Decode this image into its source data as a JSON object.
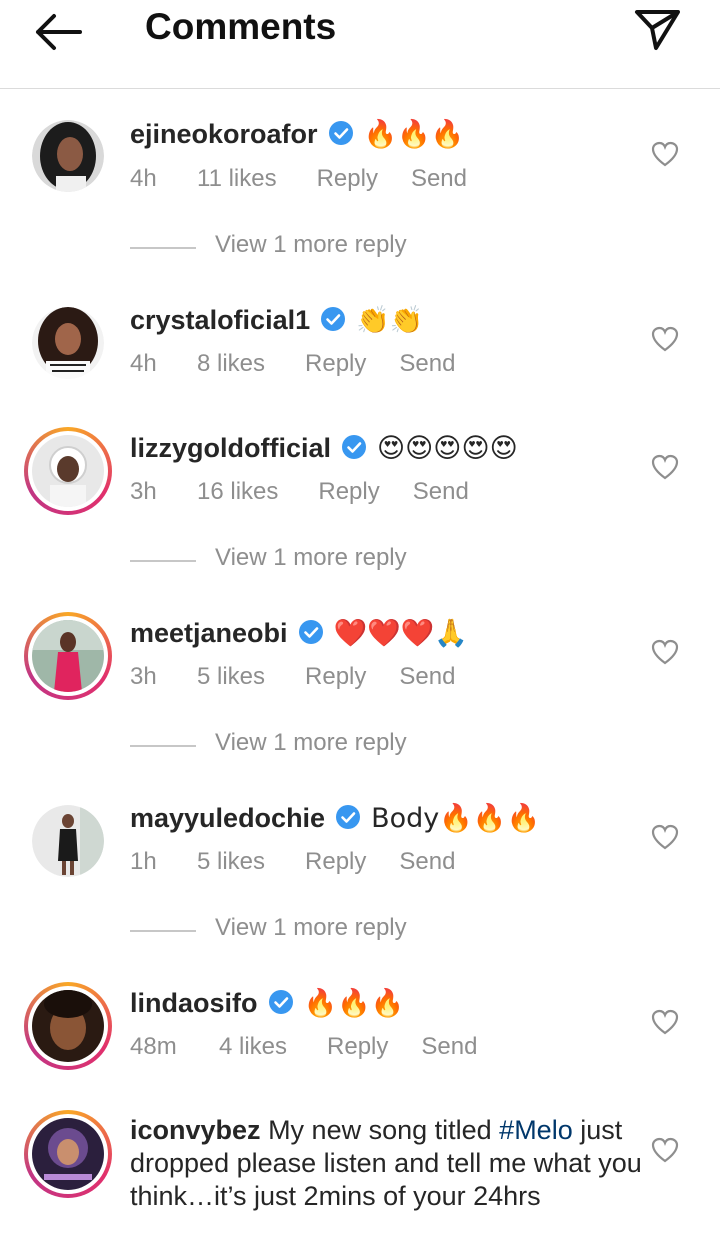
{
  "header": {
    "title": "Comments",
    "back_icon": "arrow-left-icon",
    "send_icon": "paper-plane-icon"
  },
  "comments": [
    {
      "username": "ejineokoroafor",
      "text": "🔥🔥🔥",
      "time": "4h",
      "likes": "11 likes",
      "reply": "Reply",
      "send": "Send",
      "view_more": "View 1 more reply"
    },
    {
      "username": "crystaloficial1",
      "text": "👏👏",
      "time": "4h",
      "likes": "8 likes",
      "reply": "Reply",
      "send": "Send"
    },
    {
      "username": "lizzygoldofficial",
      "text": "😍😍😍😍😍",
      "time": "3h",
      "likes": "16 likes",
      "reply": "Reply",
      "send": "Send",
      "view_more": "View 1 more reply"
    },
    {
      "username": "meetjaneobi",
      "text": "❤️❤️❤️🙏",
      "time": "3h",
      "likes": "5 likes",
      "reply": "Reply",
      "send": "Send",
      "view_more": "View 1 more reply"
    },
    {
      "username": "mayyuledochie",
      "text": "Body🔥🔥🔥",
      "time": "1h",
      "likes": "5 likes",
      "reply": "Reply",
      "send": "Send",
      "view_more": "View 1 more reply"
    },
    {
      "username": "lindaosifo",
      "text": "🔥🔥🔥",
      "time": "48m",
      "likes": "4 likes",
      "reply": "Reply",
      "send": "Send"
    },
    {
      "username": "iconvybez",
      "text_before": "My new song titled ",
      "hashtag": "#Melo",
      "text_after": " just dropped please  listen and tell me what you think…it’s just 2mins of your 24hrs"
    }
  ],
  "colors": {
    "verified": "#3897f0",
    "hashtag": "#00376b",
    "meta": "#8e8e8e",
    "story_ring_start": "#f9a826",
    "story_ring_end": "#c13584"
  }
}
